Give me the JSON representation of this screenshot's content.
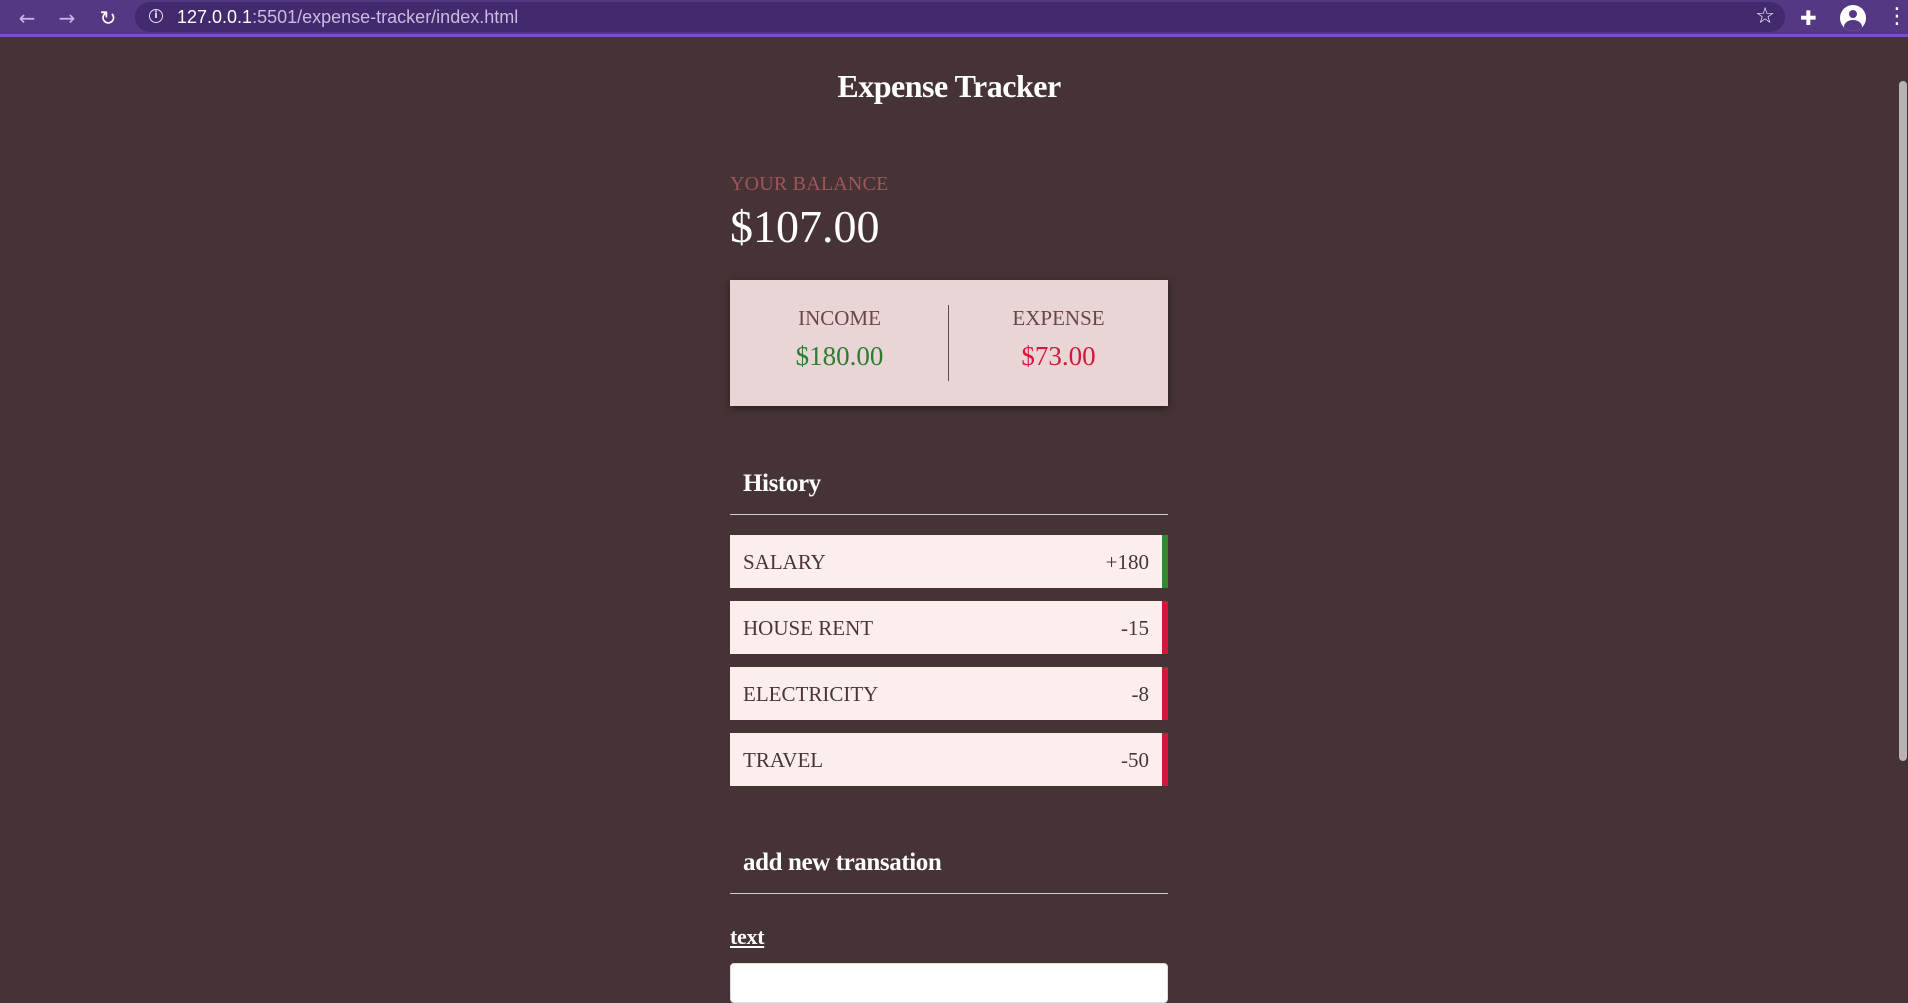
{
  "browser": {
    "url_host": "127.0.0.1",
    "url_rest": ":5501/expense-tracker/index.html"
  },
  "app": {
    "title": "Expense Tracker",
    "balance_label": "YOUR BALANCE",
    "balance_value": "$107.00",
    "income_label": "INCOME",
    "income_value": "$180.00",
    "expense_label": "EXPENSE",
    "expense_value": "$73.00",
    "history_title": "History",
    "transactions": [
      {
        "text": "SALARY",
        "amount": "+180",
        "type": "plus"
      },
      {
        "text": "HOUSE RENT",
        "amount": "-15",
        "type": "minus"
      },
      {
        "text": "ELECTRICITY",
        "amount": "-8",
        "type": "minus"
      },
      {
        "text": "TRAVEL",
        "amount": "-50",
        "type": "minus"
      }
    ],
    "add_title": "add new transation",
    "text_label": "text",
    "text_value": ""
  },
  "colors": {
    "background": "#463335",
    "income": "#2e7d2e",
    "expense": "#d0183b",
    "browser_bar": "#553883"
  },
  "icons": [
    "back-arrow-icon",
    "forward-arrow-icon",
    "reload-icon",
    "info-icon",
    "star-icon",
    "extensions-icon",
    "profile-icon",
    "menu-icon"
  ]
}
